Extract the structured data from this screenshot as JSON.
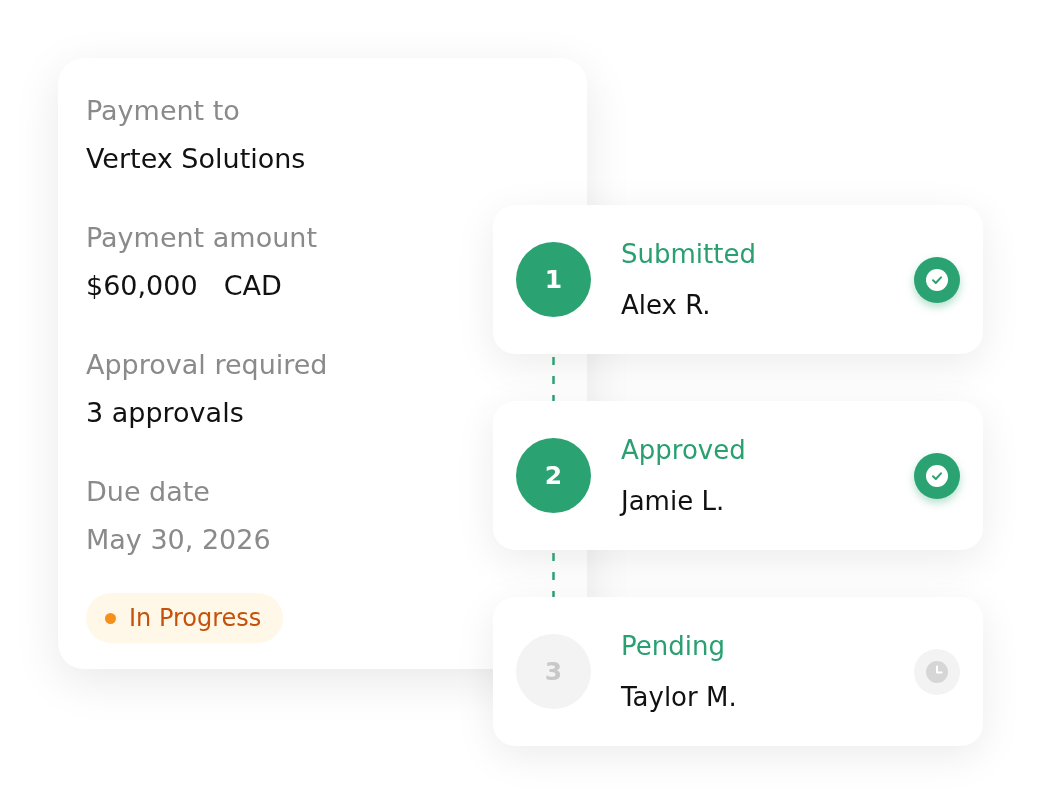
{
  "payment_card": {
    "fields": [
      {
        "label": "Payment to",
        "value": "Vertex Solutions",
        "muted": false
      },
      {
        "label": "Payment amount",
        "value": "$60,000",
        "unit": "CAD",
        "muted": false
      },
      {
        "label": "Approval required",
        "value": "3 approvals",
        "muted": false
      },
      {
        "label": "Due date",
        "value": "May 30, 2026",
        "muted": true
      }
    ],
    "status_badge": {
      "label": "In Progress"
    }
  },
  "steps": [
    {
      "number": "1",
      "status": "Submitted",
      "person": "Alex R.",
      "completed": true
    },
    {
      "number": "2",
      "status": "Approved",
      "person": "Jamie L.",
      "completed": true
    },
    {
      "number": "3",
      "status": "Pending",
      "person": "Taylor M.",
      "completed": false
    }
  ]
}
